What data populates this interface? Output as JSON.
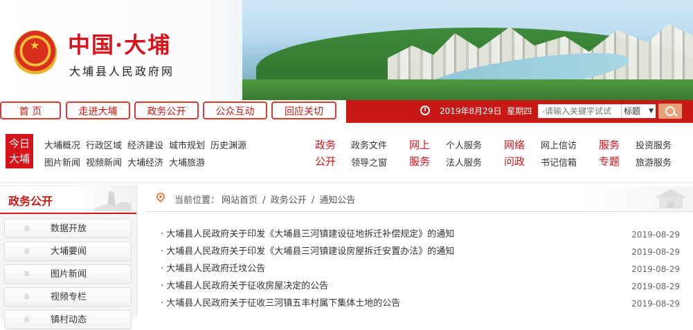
{
  "header": {
    "title": "中国·大埔",
    "subtitle": "大埔县人民政府网"
  },
  "nav": {
    "tabs": [
      {
        "label": "首 页"
      },
      {
        "label": "走进大埔"
      },
      {
        "label": "政务公开"
      },
      {
        "label": "公众互动"
      },
      {
        "label": "回应关切"
      }
    ],
    "date": "2019年8月29日",
    "weekday": "星期四",
    "search": {
      "placeholder": "-请输入关键字试试",
      "select_value": "标题",
      "select_arrow": "▼"
    }
  },
  "quick": {
    "today_line1": "今日",
    "today_line2": "大埔",
    "today_links": [
      "大埔概况",
      "行政区域",
      "经济建设",
      "城市规划",
      "历史渊源",
      "图片新闻",
      "视频新闻",
      "大埔经济",
      "大埔旅游"
    ],
    "sections": [
      {
        "head1": "政务",
        "head2": "公开",
        "links": [
          "政务文件",
          "领导之窗"
        ]
      },
      {
        "head1": "网上",
        "head2": "服务",
        "links": [
          "个人服务",
          "法人服务"
        ]
      },
      {
        "head1": "网络",
        "head2": "问政",
        "links": [
          "网上信访",
          "书记信箱"
        ]
      },
      {
        "head1": "服务",
        "head2": "专题",
        "links": [
          "投资服务",
          "旅游服务"
        ]
      }
    ]
  },
  "sidebar": {
    "title": "政务公开",
    "items": [
      {
        "label": "数据开放"
      },
      {
        "label": "大埔要闻"
      },
      {
        "label": "图片新闻"
      },
      {
        "label": "视频专栏"
      },
      {
        "label": "镇村动态"
      }
    ]
  },
  "main": {
    "breadcrumb": [
      "当前位置：",
      "网站首页",
      "/",
      "政务公开",
      "/",
      "通知公告"
    ],
    "news": [
      {
        "title": "· 大埔县人民政府关于印发《大埔县三河镇建设征地拆迁补偿规定》的通知",
        "date": "2019-08-29"
      },
      {
        "title": "· 大埔县人民政府关于印发《大埔县三河镇建设房屋拆迁安置办法》的通知",
        "date": "2019-08-29"
      },
      {
        "title": "· 大埔县人民政府迁坟公告",
        "date": "2019-08-29"
      },
      {
        "title": "· 大埔县人民政府关于征收房屋决定的公告",
        "date": "2019-08-29"
      },
      {
        "title": "· 大埔县人民政府关于征收三河镇五丰村属下集体土地的公告",
        "date": "2019-08-29"
      }
    ]
  },
  "colors": {
    "brand_red": "#c81914",
    "title_red": "#d4141a",
    "accent_orange": "#e5874c"
  }
}
